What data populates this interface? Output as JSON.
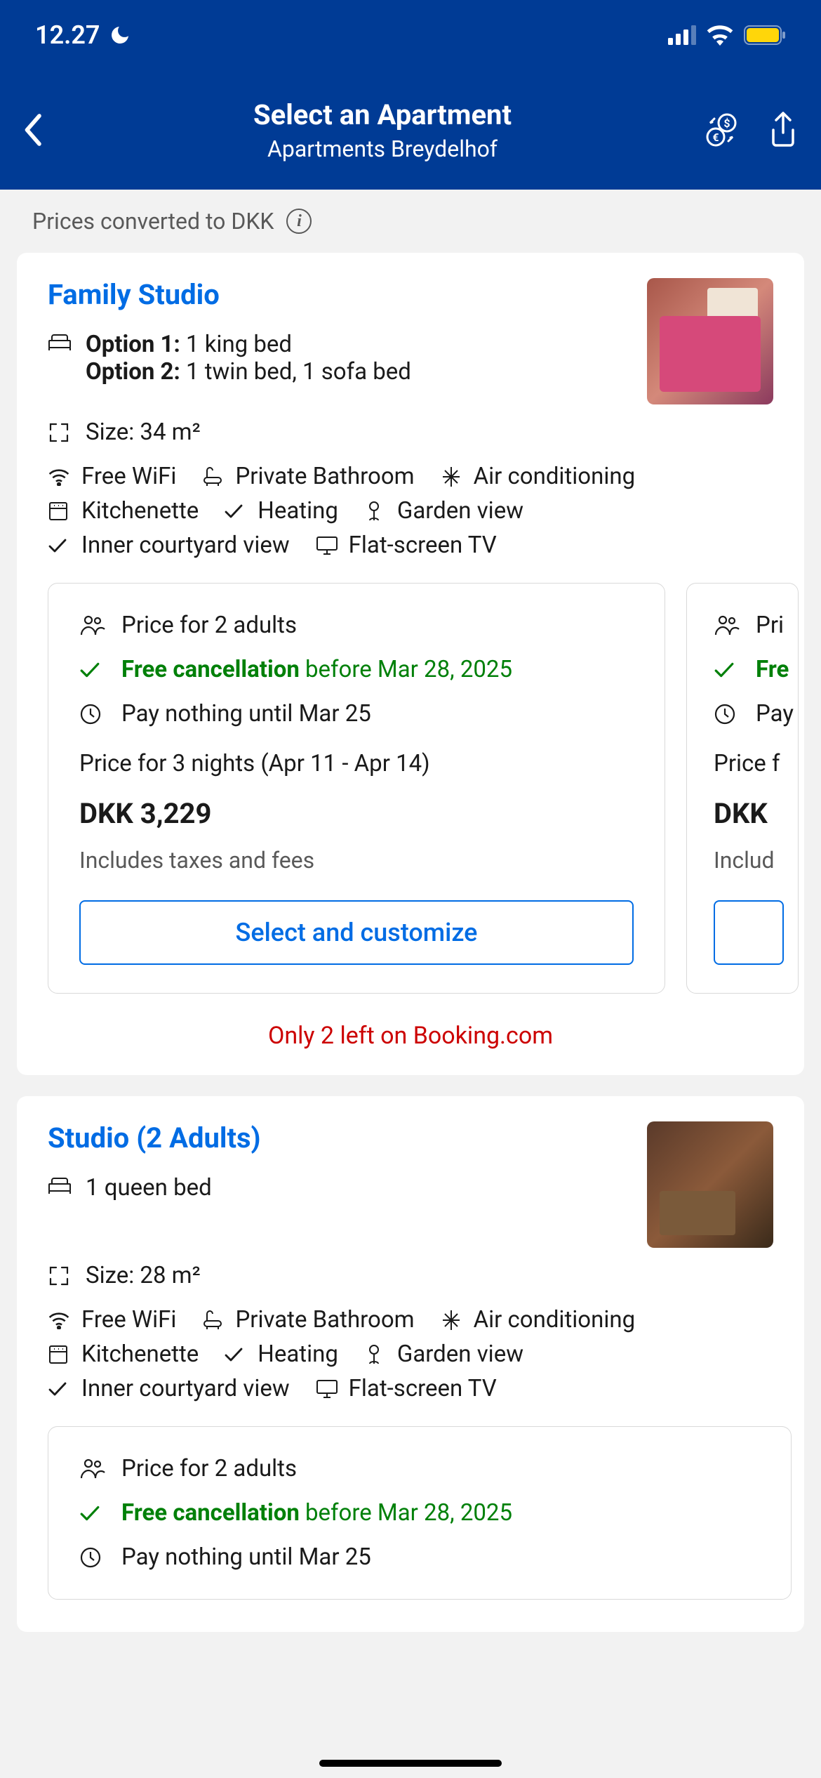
{
  "status": {
    "time": "12.27"
  },
  "nav": {
    "title": "Select an Apartment",
    "subtitle": "Apartments Breydelhof"
  },
  "conversion": "Prices converted to DKK",
  "rooms": [
    {
      "title": "Family Studio",
      "option1_label": "Option 1:",
      "option1_value": " 1 king bed",
      "option2_label": "Option 2:",
      "option2_value": " 1 twin bed, 1 sofa bed",
      "size": "Size: 34 m²",
      "amenities": [
        "Free WiFi",
        "Private Bathroom",
        "Air conditioning",
        "Kitchenette",
        "Heating",
        "Garden view",
        "Inner courtyard view",
        "Flat-screen TV"
      ],
      "offers": [
        {
          "guests": "Price for 2 adults",
          "cancel_bold": "Free cancellation",
          "cancel_rest": " before Mar 28, 2025",
          "pay": "Pay nothing until Mar 25",
          "nights": "Price for 3 nights (Apr 11 - Apr 14)",
          "price": "DKK 3,229",
          "tax": "Includes taxes and fees",
          "button": "Select and customize"
        },
        {
          "guests": "Pri",
          "cancel_bold": "Fre",
          "cancel_rest": "",
          "pay": "Pay",
          "nights": "Price f",
          "price": "DKK ",
          "tax": "Includ",
          "button": ""
        }
      ],
      "scarcity": "Only 2 left on Booking.com"
    },
    {
      "title": "Studio (2 Adults)",
      "bed": "1 queen bed",
      "size": "Size: 28 m²",
      "amenities": [
        "Free WiFi",
        "Private Bathroom",
        "Air conditioning",
        "Kitchenette",
        "Heating",
        "Garden view",
        "Inner courtyard view",
        "Flat-screen TV"
      ],
      "offers": [
        {
          "guests": "Price for 2 adults",
          "cancel_bold": "Free cancellation",
          "cancel_rest": " before Mar 28, 2025",
          "pay": "Pay nothing until Mar 25"
        }
      ]
    }
  ]
}
